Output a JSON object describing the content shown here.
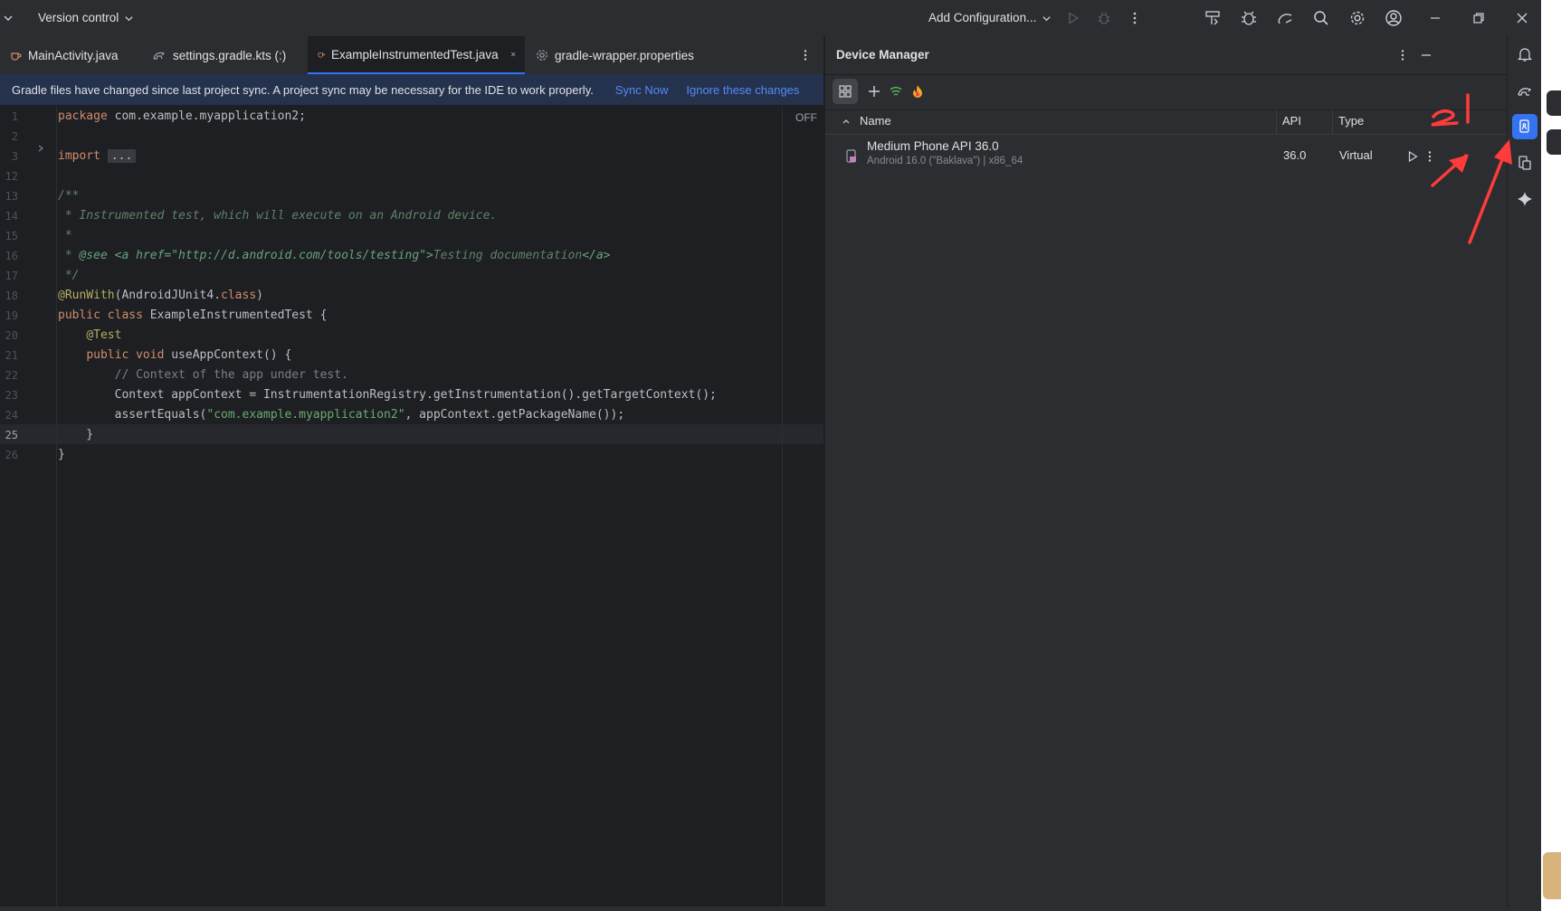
{
  "titlebar": {
    "version_control": "Version control",
    "run_config": "Add Configuration..."
  },
  "tabs": [
    {
      "label": "MainActivity.java"
    },
    {
      "label": "settings.gradle.kts (:)"
    },
    {
      "label": "ExampleInstrumentedTest.java",
      "active": true
    },
    {
      "label": "gradle-wrapper.properties"
    }
  ],
  "banner": {
    "message": "Gradle files have changed since last project sync. A project sync may be necessary for the IDE to work properly.",
    "sync_now": "Sync Now",
    "ignore": "Ignore these changes"
  },
  "editor": {
    "inspection_state": "OFF",
    "current_line": "25",
    "lines": [
      {
        "n": "1",
        "parts": [
          [
            "kw",
            "package"
          ],
          [
            "p",
            " com.example.myapplication2;"
          ]
        ]
      },
      {
        "n": "2",
        "parts": []
      },
      {
        "n": "3",
        "parts": [
          [
            "kw",
            "import"
          ],
          [
            "p",
            " "
          ],
          [
            "fold",
            "..."
          ]
        ]
      },
      {
        "n": "12",
        "parts": []
      },
      {
        "n": "13",
        "parts": [
          [
            "dc",
            "/**"
          ]
        ]
      },
      {
        "n": "14",
        "parts": [
          [
            "dc",
            " * Instrumented test, which will execute on an Android device."
          ]
        ]
      },
      {
        "n": "15",
        "parts": [
          [
            "dc",
            " *"
          ]
        ]
      },
      {
        "n": "16",
        "parts": [
          [
            "dc",
            " * "
          ],
          [
            "dct",
            "@see <a href=\"http://d.android.com/tools/testing\">"
          ],
          [
            "dc",
            "Testing documentation"
          ],
          [
            "dct",
            "</a>"
          ]
        ]
      },
      {
        "n": "17",
        "parts": [
          [
            "dc",
            " */"
          ]
        ]
      },
      {
        "n": "18",
        "parts": [
          [
            "an",
            "@RunWith"
          ],
          [
            "p",
            "(AndroidJUnit4."
          ],
          [
            "kw",
            "class"
          ],
          [
            "p",
            ")"
          ]
        ]
      },
      {
        "n": "19",
        "parts": [
          [
            "kw",
            "public class"
          ],
          [
            "p",
            " ExampleInstrumentedTest {"
          ]
        ]
      },
      {
        "n": "20",
        "parts": [
          [
            "p",
            "    "
          ],
          [
            "an",
            "@Test"
          ]
        ]
      },
      {
        "n": "21",
        "parts": [
          [
            "p",
            "    "
          ],
          [
            "kw",
            "public void"
          ],
          [
            "p",
            " useAppContext() {"
          ]
        ]
      },
      {
        "n": "22",
        "parts": [
          [
            "cm",
            "        // Context of the app under test."
          ]
        ]
      },
      {
        "n": "23",
        "parts": [
          [
            "p",
            "        Context appContext = InstrumentationRegistry.getInstrumentation().getTargetContext();"
          ]
        ]
      },
      {
        "n": "24",
        "parts": [
          [
            "p",
            "        assertEquals("
          ],
          [
            "st",
            "\"com.example.myapplication2\""
          ],
          [
            "p",
            ", appContext.getPackageName());"
          ]
        ]
      },
      {
        "n": "25",
        "parts": [
          [
            "p",
            "    }"
          ]
        ]
      },
      {
        "n": "26",
        "parts": [
          [
            "p",
            "}"
          ]
        ]
      }
    ]
  },
  "device_manager": {
    "title": "Device Manager",
    "columns": {
      "name": "Name",
      "api": "API",
      "type": "Type"
    },
    "devices": [
      {
        "name": "Medium Phone API 36.0",
        "details": "Android 16.0 (\"Baklava\") | x86_64",
        "api": "36.0",
        "type": "Virtual"
      }
    ]
  },
  "annotations": {
    "mark1": "1",
    "mark2": "2"
  },
  "colors": {
    "accent": "#3574f0",
    "annotation": "#ff3b3b",
    "banner_bg": "#25324d"
  }
}
